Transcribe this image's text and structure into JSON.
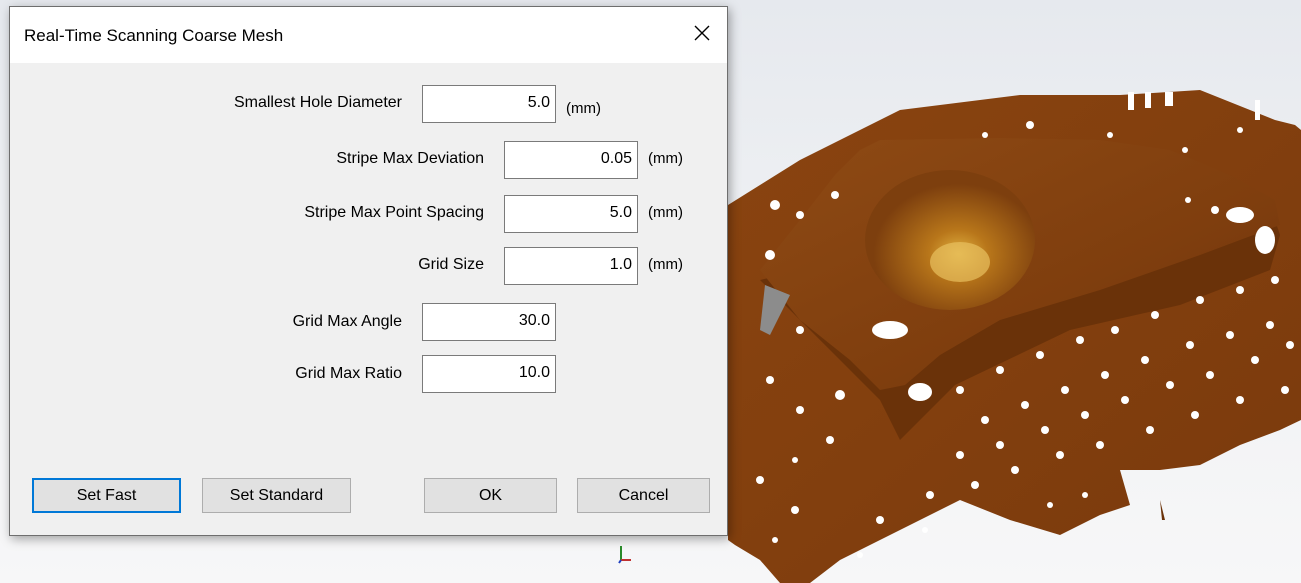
{
  "dialog": {
    "title": "Real-Time Scanning Coarse Mesh",
    "fields": [
      {
        "label": "Smallest Hole Diameter",
        "value": "5.0",
        "unit": "(mm)"
      },
      {
        "label": "Stripe Max Deviation",
        "value": "0.05",
        "unit": "(mm)"
      },
      {
        "label": "Stripe Max Point Spacing",
        "value": "5.0",
        "unit": "(mm)"
      },
      {
        "label": "Grid Size",
        "value": "1.0",
        "unit": "(mm)"
      },
      {
        "label": "Grid Max Angle",
        "value": "30.0",
        "unit": ""
      },
      {
        "label": "Grid Max Ratio",
        "value": "10.0",
        "unit": ""
      }
    ],
    "buttons": {
      "set_fast": "Set Fast",
      "set_standard": "Set Standard",
      "ok": "OK",
      "cancel": "Cancel"
    }
  },
  "viewport": {
    "mesh_color": "#8b4513",
    "background_color": "#eceef1"
  },
  "icons": {
    "close": "close-icon",
    "axis": "axis-triad-icon"
  }
}
